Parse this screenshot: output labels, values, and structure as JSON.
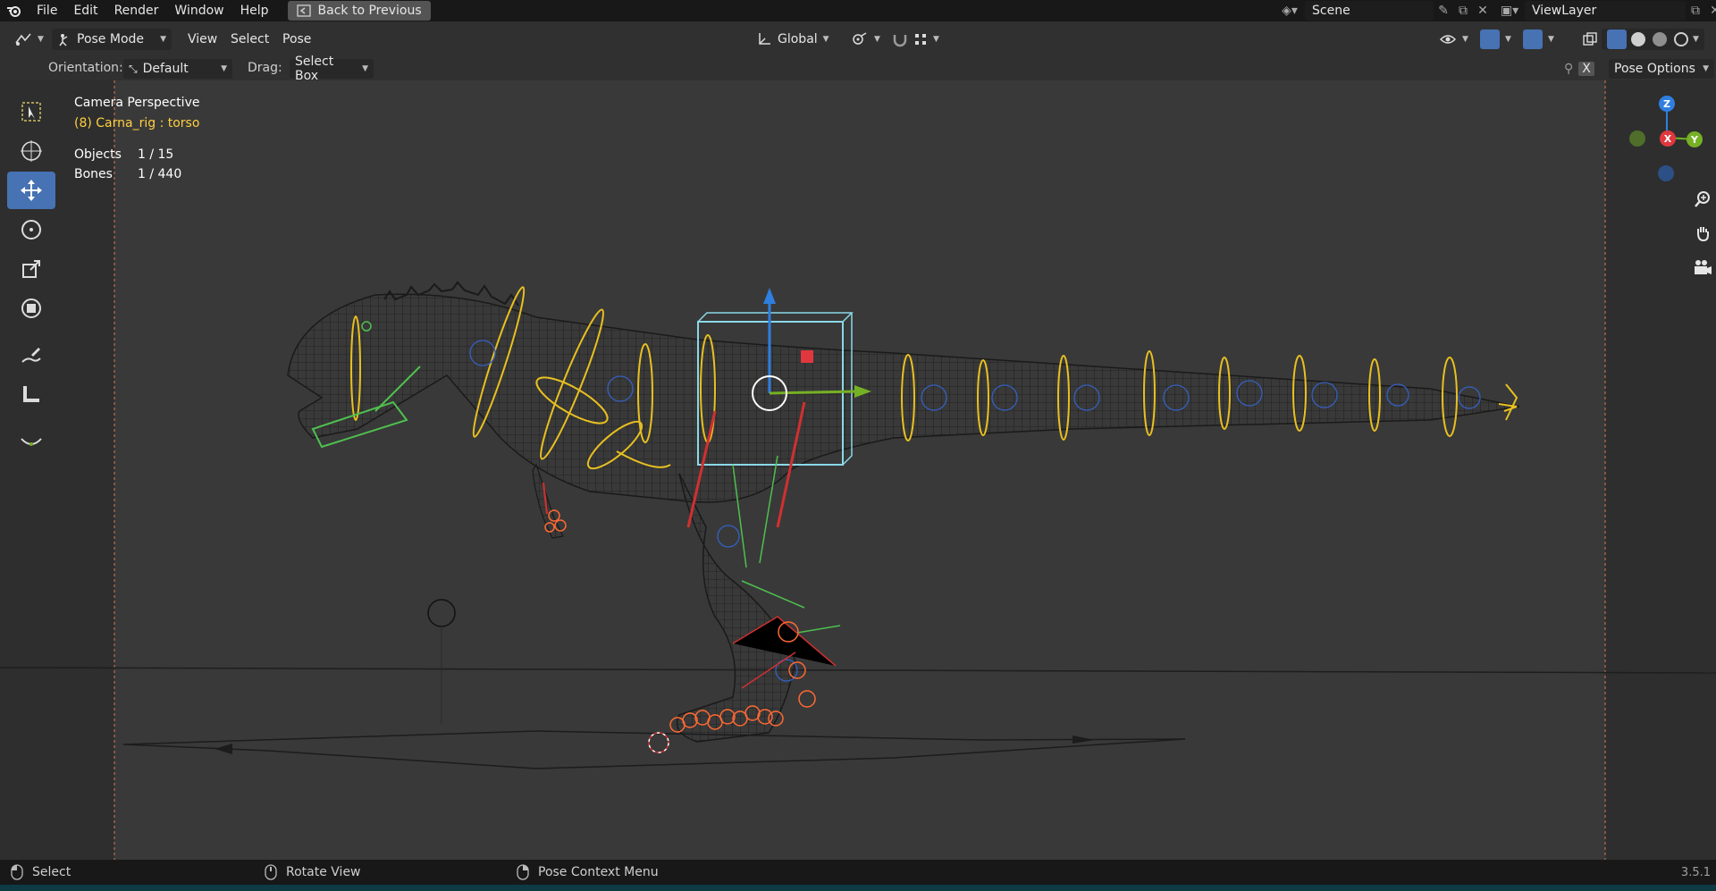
{
  "topbar": {
    "menus": [
      "File",
      "Edit",
      "Render",
      "Window",
      "Help"
    ],
    "back_label": "Back to Previous",
    "scene_name": "Scene",
    "viewlayer_name": "ViewLayer"
  },
  "header": {
    "mode": "Pose Mode",
    "menus": [
      "View",
      "Select",
      "Pose"
    ],
    "transform_orientation": "Global",
    "pose_options": "Pose Options"
  },
  "toolsettings": {
    "orientation_label": "Orientation:",
    "orientation_value": "Default",
    "drag_label": "Drag:",
    "drag_value": "Select Box"
  },
  "viewport": {
    "title": "Camera Perspective",
    "subtitle": "(8) Carna_rig : torso",
    "stats": [
      {
        "label": "Objects",
        "value": "1 / 15"
      },
      {
        "label": "Bones",
        "value": "1 / 440"
      }
    ],
    "gizmo_axes": {
      "z": "Z",
      "x": "X",
      "y": "Y"
    }
  },
  "statusbar": {
    "select": "Select",
    "rotate": "Rotate View",
    "context": "Pose Context Menu",
    "version": "3.5.1"
  },
  "colors": {
    "accent": "#4772b3",
    "bone_yellow": "#e8c020",
    "axis_x": "#e0383e",
    "axis_y": "#76b025",
    "axis_z": "#2e7fe0"
  },
  "icons": [
    "blender-logo",
    "select-box-tool",
    "cursor-tool",
    "move-tool",
    "rotate-tool",
    "scale-tool",
    "transform-tool",
    "annotate-tool",
    "measure-tool",
    "relax-tool",
    "zoom-icon",
    "pan-hand-icon",
    "camera-icon"
  ]
}
